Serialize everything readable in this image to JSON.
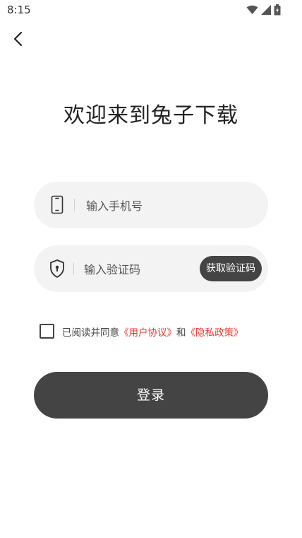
{
  "status_bar": {
    "time": "8:15"
  },
  "title": "欢迎来到兔子下载",
  "phone_field": {
    "placeholder": "输入手机号"
  },
  "code_field": {
    "placeholder": "输入验证码",
    "button_label": "获取验证码"
  },
  "agreement": {
    "prefix": "已阅读并同意",
    "user_agreement": "《用户协议》",
    "conjunction": "和",
    "privacy_policy": "《隐私政策》",
    "checked": false
  },
  "login_label": "登录",
  "colors": {
    "accent_dark": "#444444",
    "link_red": "#e53935",
    "field_bg": "#f3f3f3"
  }
}
